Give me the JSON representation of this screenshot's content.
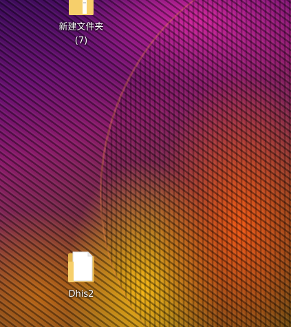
{
  "desktop": {
    "icons": [
      {
        "label_line1": "新建文件夹",
        "label_line2": "(7)",
        "icon": "folder-icon"
      },
      {
        "label_line1": "Dhis2",
        "icon": "folder-with-document-icon"
      }
    ]
  }
}
